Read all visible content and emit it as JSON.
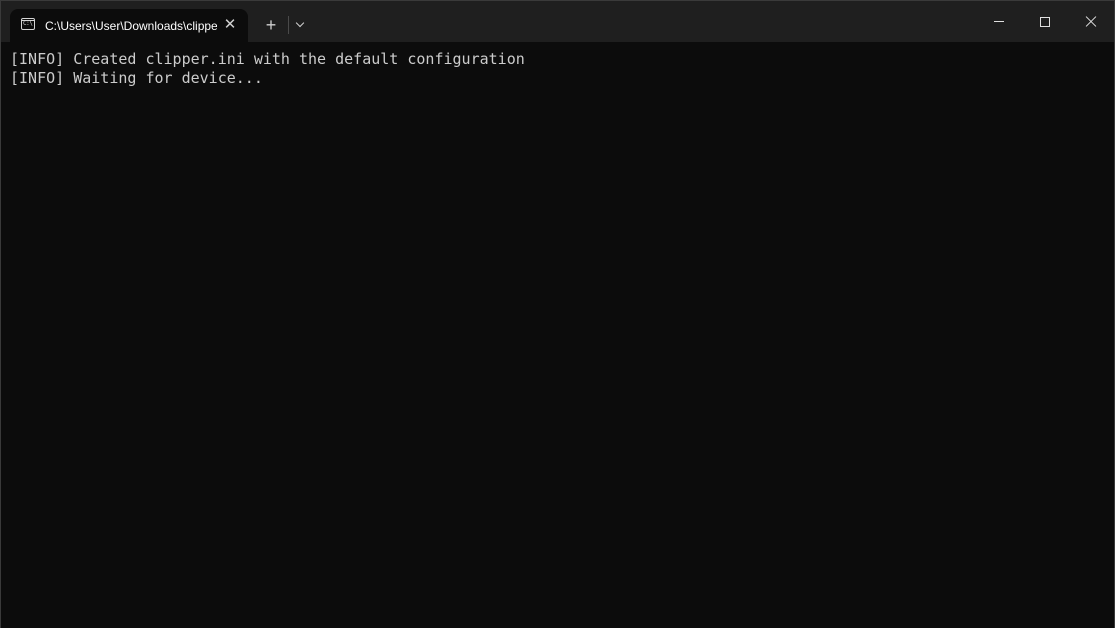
{
  "tab": {
    "title": "C:\\Users\\User\\Downloads\\clipper.exe",
    "icon": "terminal-icon",
    "icon_glyph": "C:\\",
    "close_icon": "close-icon"
  },
  "toolbar": {
    "new_tab_icon": "plus-icon",
    "new_tab_glyph": "+",
    "dropdown_icon": "chevron-down-icon",
    "close_glyph": "✕"
  },
  "window_controls": {
    "minimize_icon": "minimize-icon",
    "maximize_icon": "maximize-icon",
    "close_icon": "close-icon"
  },
  "terminal": {
    "lines": [
      "[INFO] Created clipper.ini with the default configuration",
      "[INFO] Waiting for device..."
    ]
  },
  "colors": {
    "background": "#0c0c0c",
    "titlebar": "#1f1f1f",
    "text": "#cccccc"
  }
}
